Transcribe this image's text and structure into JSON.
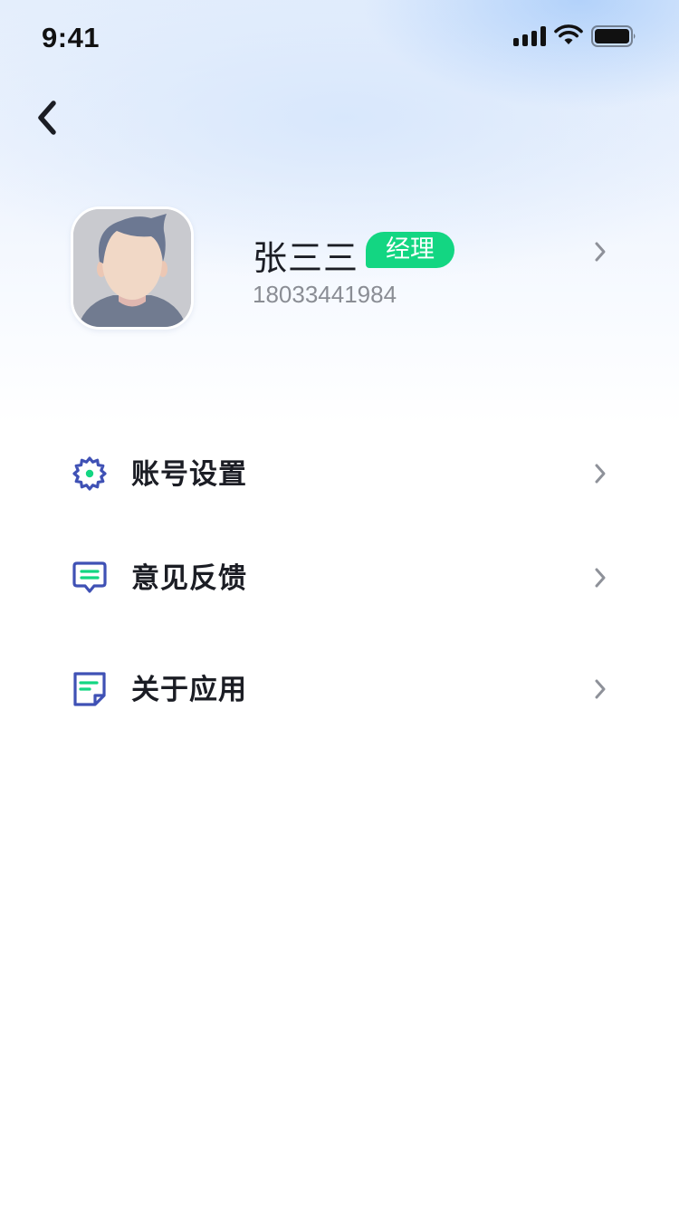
{
  "status_bar": {
    "time": "9:41",
    "icons": [
      "cellular-signal-icon",
      "wifi-icon",
      "battery-icon"
    ]
  },
  "nav": {
    "back_icon": "chevron-left-icon"
  },
  "profile": {
    "name": "张三三",
    "role": "经理",
    "phone": "18033441984",
    "avatar_icon": "user-avatar-icon"
  },
  "menu": {
    "items": [
      {
        "label": "账号设置",
        "icon": "gear-icon"
      },
      {
        "label": "意见反馈",
        "icon": "feedback-message-icon"
      },
      {
        "label": "关于应用",
        "icon": "document-icon"
      }
    ]
  },
  "colors": {
    "accent_green": "#13D682",
    "icon_blue": "#3F51B5",
    "text_primary": "#1B1D24",
    "text_secondary": "#8A8D94",
    "chevron": "#8E9199"
  }
}
